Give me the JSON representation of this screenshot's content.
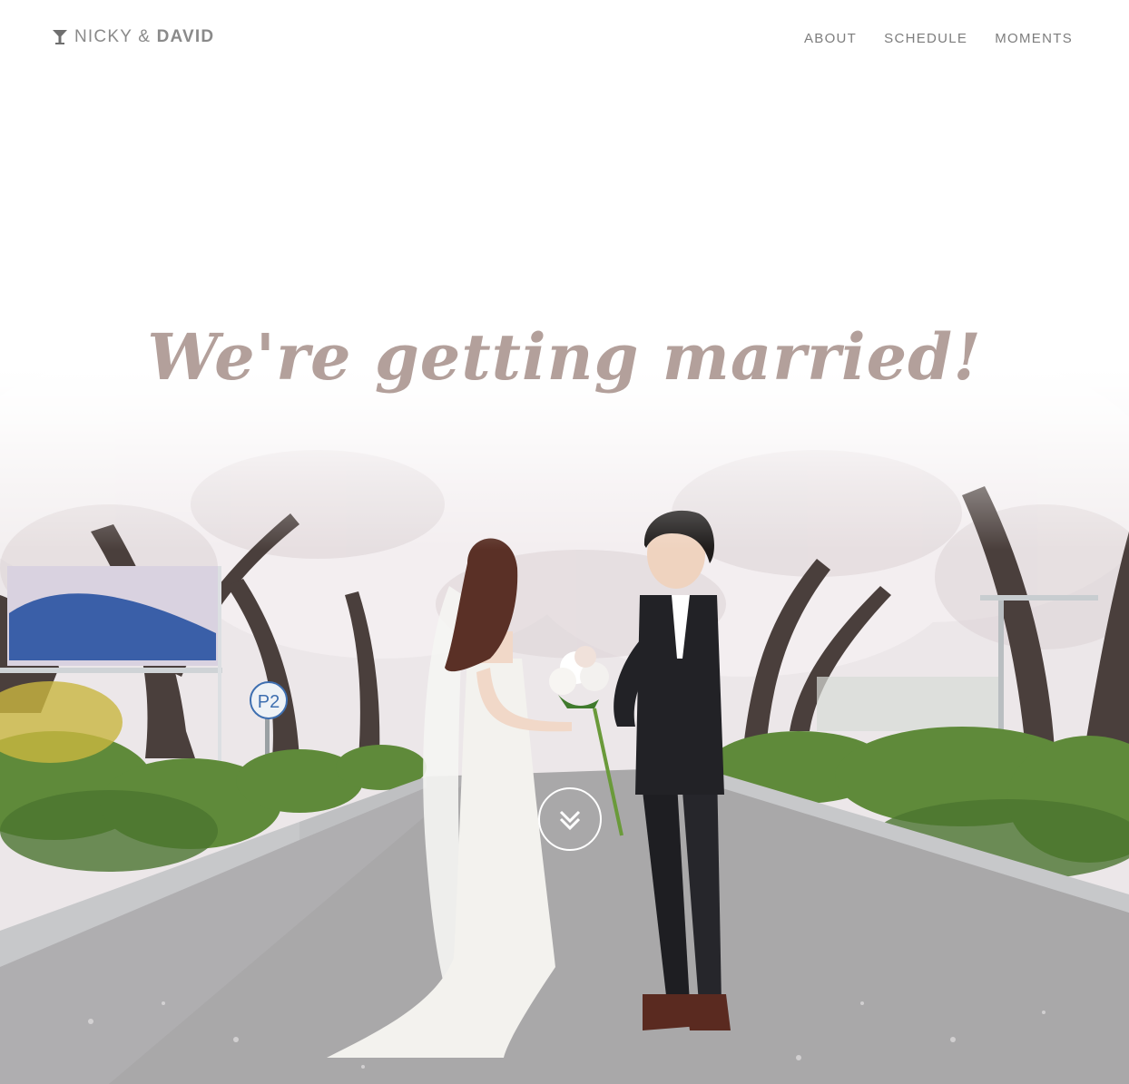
{
  "header": {
    "brand": {
      "name1": "NICKY",
      "separator": "&",
      "name2": "DAVID",
      "icon": "cocktail-glass-icon"
    },
    "nav": [
      "ABOUT",
      "SCHEDULE",
      "MOMENTS"
    ]
  },
  "hero": {
    "headline": "We're getting married!",
    "sign_text": "P2",
    "scroll_icon": "chevron-double-down-icon"
  },
  "colors": {
    "nav_text": "#7d7d7d",
    "headline": "#b3a09b",
    "background": "#ffffff"
  }
}
